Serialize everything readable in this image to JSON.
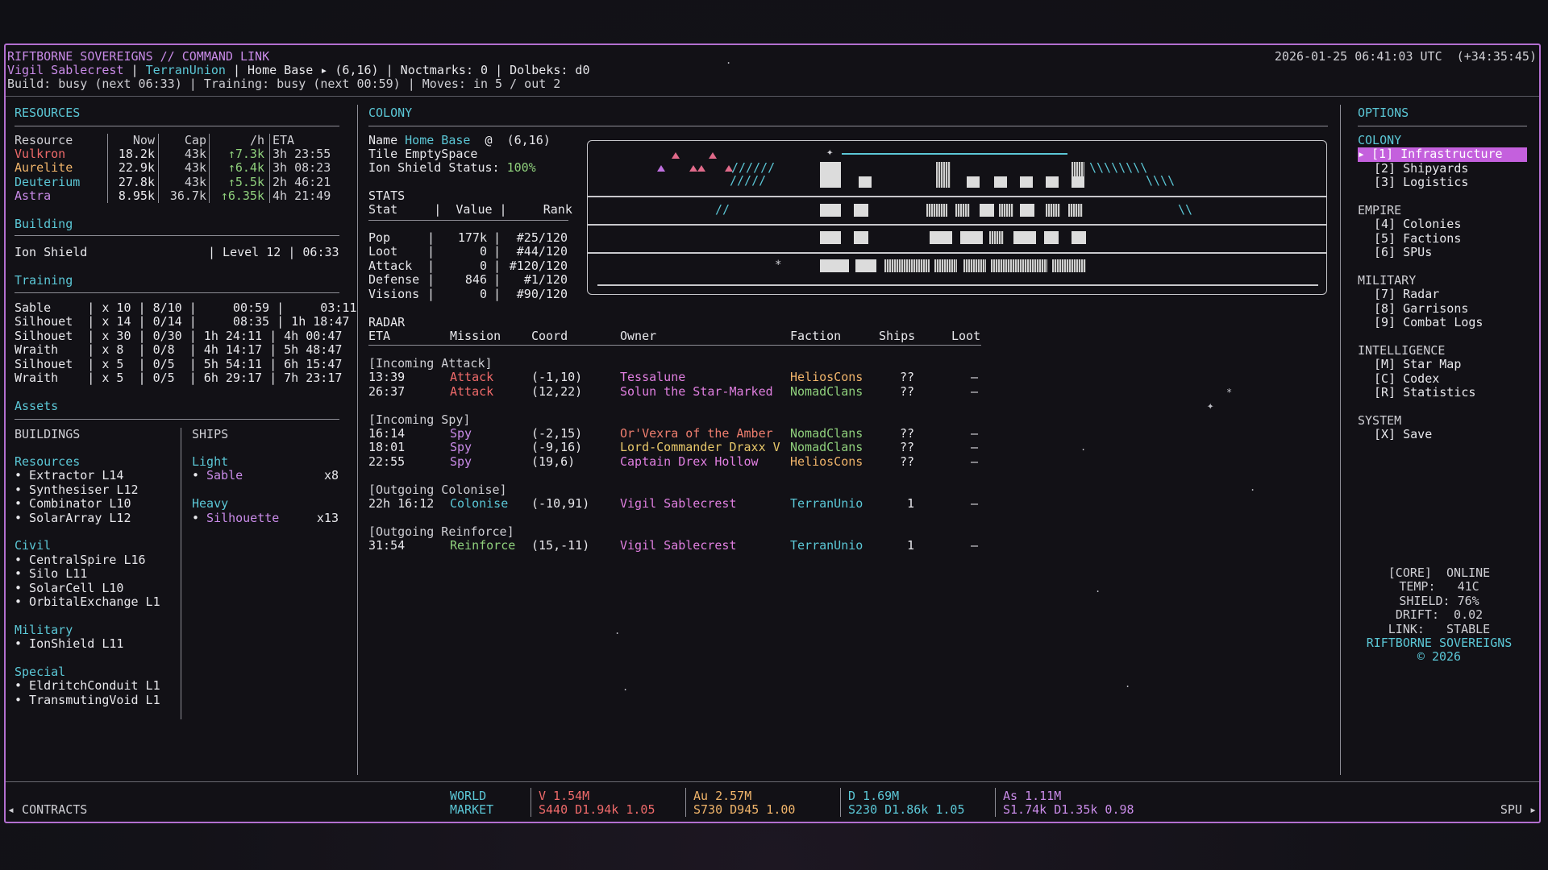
{
  "header": {
    "title": "RIFTBORNE SOVEREIGNS // COMMAND LINK",
    "clock": "2026-01-25 06:41:03 UTC  (+34:35:45)",
    "player": "Vigil Sablecrest",
    "sep1": " | ",
    "faction": "TerranUnion",
    "rest_line1": " | Home Base ▸ (6,16) | Noctmarks: 0 | Dolbeks: d0",
    "line2": "Build: busy (next 06:33) | Training: busy (next 00:59) | Moves: in 5 / out 2"
  },
  "resources": {
    "heading": "RESOURCES",
    "columns": [
      "Resource",
      "Now",
      "Cap",
      "/h",
      "ETA"
    ],
    "rows": [
      {
        "name": "Vulkron",
        "now": "18.2k",
        "cap": "43k",
        "rate": "↑7.3k",
        "eta": "3h 23:55",
        "color": "#ef6a6a"
      },
      {
        "name": "Aurelite",
        "now": "22.9k",
        "cap": "43k",
        "rate": "↑6.4k",
        "eta": "3h 08:23",
        "color": "#f0b46a"
      },
      {
        "name": "Deuterium",
        "now": "27.8k",
        "cap": "43k",
        "rate": "↑5.5k",
        "eta": "2h 46:21",
        "color": "#5bc7d6"
      },
      {
        "name": "Astra",
        "now": "8.95k",
        "cap": "36.7k",
        "rate": "↑6.35k",
        "eta": "4h 21:49",
        "color": "#c98be8"
      }
    ]
  },
  "building": {
    "heading": "Building",
    "name": "Ion Shield",
    "level": "| Level 12 | 06:33"
  },
  "training": {
    "heading": "Training",
    "rows": [
      "Sable     | x 10 | 8/10 |     00:59 |     03:11",
      "Silhouet  | x 14 | 0/14 |     08:35 | 1h 18:47",
      "Silhouet  | x 30 | 0/30 | 1h 24:11 | 4h 00:47",
      "Wraith    | x 8  | 0/8  | 4h 14:17 | 5h 48:47",
      "Silhouet  | x 5  | 0/5  | 5h 54:11 | 6h 15:47",
      "Wraith    | x 5  | 0/5  | 6h 29:17 | 7h 23:17"
    ]
  },
  "assets": {
    "heading": "Assets",
    "buildings_heading": "BUILDINGS",
    "ships_heading": "SHIPS",
    "groups": [
      {
        "title": "Resources",
        "items": [
          "• Extractor L14",
          "• Synthesiser L12",
          "• Combinator L10",
          "• SolarArray L12"
        ]
      },
      {
        "title": "Civil",
        "items": [
          "• CentralSpire L16",
          "• Silo L11",
          "• SolarCell L10",
          "• OrbitalExchange L1"
        ]
      },
      {
        "title": "Military",
        "items": [
          "• IonShield L11"
        ]
      },
      {
        "title": "Special",
        "items": [
          "• EldritchConduit L1",
          "• TransmutingVoid L1"
        ]
      }
    ],
    "ships": [
      {
        "title": "Light",
        "name": "Sable",
        "count": "x8"
      },
      {
        "title": "Heavy",
        "name": "Silhouette",
        "count": "x13"
      }
    ]
  },
  "colony": {
    "heading": "COLONY",
    "name_label": "Name ",
    "name_value": "Home Base",
    "coord": "  @  (6,16)",
    "tile": "Tile EmptySpace",
    "shield_label": "Ion Shield Status: ",
    "shield_value": "100%",
    "stats_heading": "STATS",
    "stats_header": "Stat     |  Value |     Rank",
    "stats": [
      {
        "stat": "Pop",
        "value": "177k",
        "rank": "#25/120"
      },
      {
        "stat": "Loot",
        "value": "0",
        "rank": "#44/120"
      },
      {
        "stat": "Attack",
        "value": "0",
        "rank": "#120/120"
      },
      {
        "stat": "Defense",
        "value": "846",
        "rank": "#1/120"
      },
      {
        "stat": "Visions",
        "value": "0",
        "rank": "#90/120"
      }
    ]
  },
  "radar": {
    "heading": "RADAR",
    "columns": [
      "ETA",
      "Mission",
      "Coord",
      "Owner",
      "Faction",
      "Ships",
      "Loot"
    ],
    "groups": [
      {
        "title": "[Incoming Attack]",
        "rows": [
          {
            "eta": "13:39",
            "mission": "Attack",
            "coord": "(-1,10)",
            "owner": "Tessalune",
            "faction": "HeliosCons",
            "ships": "??",
            "loot": "–",
            "mc": "#ef6a6a",
            "oc": "#e07fe0",
            "fc": "#f0b46a"
          },
          {
            "eta": "26:37",
            "mission": "Attack",
            "coord": "(12,22)",
            "owner": "Solun the Star-Marked",
            "faction": "NomadClans",
            "ships": "??",
            "loot": "–",
            "mc": "#ef6a6a",
            "oc": "#e07fe0",
            "fc": "#8fd07c"
          }
        ]
      },
      {
        "title": "[Incoming Spy]",
        "rows": [
          {
            "eta": "16:14",
            "mission": "Spy",
            "coord": "(-2,15)",
            "owner": "Or'Vexra of the Amber",
            "faction": "NomadClans",
            "ships": "??",
            "loot": "–",
            "mc": "#c98be8",
            "oc": "#f07f6f",
            "fc": "#8fd07c"
          },
          {
            "eta": "18:01",
            "mission": "Spy",
            "coord": "(-9,16)",
            "owner": "Lord-Commander Draxx V",
            "faction": "NomadClans",
            "ships": "??",
            "loot": "–",
            "mc": "#c98be8",
            "oc": "#e8c86a",
            "fc": "#8fd07c"
          },
          {
            "eta": "22:55",
            "mission": "Spy",
            "coord": "(19,6)",
            "owner": "Captain Drex Hollow",
            "faction": "HeliosCons",
            "ships": "??",
            "loot": "–",
            "mc": "#c98be8",
            "oc": "#e07fe0",
            "fc": "#f0b46a"
          }
        ]
      },
      {
        "title": "[Outgoing Colonise]",
        "rows": [
          {
            "eta": "22h 16:12",
            "mission": "Colonise",
            "coord": "(-10,91)",
            "owner": "Vigil Sablecrest",
            "faction": "TerranUnio",
            "ships": "1",
            "loot": "–",
            "mc": "#5bc7d6",
            "oc": "#e07fe0",
            "fc": "#5bc7d6"
          }
        ]
      },
      {
        "title": "[Outgoing Reinforce]",
        "rows": [
          {
            "eta": "31:54",
            "mission": "Reinforce",
            "coord": "(15,-11)",
            "owner": "Vigil Sablecrest",
            "faction": "TerranUnio",
            "ships": "1",
            "loot": "–",
            "mc": "#8fd07c",
            "oc": "#e07fe0",
            "fc": "#5bc7d6"
          }
        ]
      }
    ]
  },
  "options": {
    "heading": "OPTIONS",
    "sections": [
      {
        "title": "COLONY",
        "items": [
          "[1] Infrastructure",
          "[2] Shipyards",
          "[3] Logistics"
        ]
      },
      {
        "title": "EMPIRE",
        "items": [
          "[4] Colonies",
          "[5] Factions",
          "[6] SPUs"
        ]
      },
      {
        "title": "MILITARY",
        "items": [
          "[7] Radar",
          "[8] Garrisons",
          "[9] Combat Logs"
        ]
      },
      {
        "title": "INTELLIGENCE",
        "items": [
          "[M] Star Map",
          "[C] Codex",
          "[R] Statistics"
        ]
      },
      {
        "title": "SYSTEM",
        "items": [
          "[X] Save"
        ]
      }
    ],
    "selected_marker": "▸"
  },
  "core": {
    "lines": [
      "[CORE]  ONLINE",
      "TEMP:   41C",
      "SHIELD: 76%",
      "DRIFT:  0.02",
      "LINK:   STABLE"
    ],
    "brand": "RIFTBORNE SOVEREIGNS",
    "copyright": "© 2026"
  },
  "footer": {
    "contracts": "◂ CONTRACTS",
    "world": "WORLD",
    "market": "MARKET",
    "spu": "SPU ▸",
    "markets": [
      {
        "head": "V 1.54M",
        "detail": "S440 D1.94k 1.05",
        "color": "#ef6a6a"
      },
      {
        "head": "Au 2.57M",
        "detail": "S730 D945 1.00",
        "color": "#f0b46a"
      },
      {
        "head": "D 1.69M",
        "detail": "S230 D1.86k 1.05",
        "color": "#5bc7d6"
      },
      {
        "head": "As 1.11M",
        "detail": "S1.74k D1.35k 0.98",
        "color": "#c98be8"
      }
    ]
  }
}
